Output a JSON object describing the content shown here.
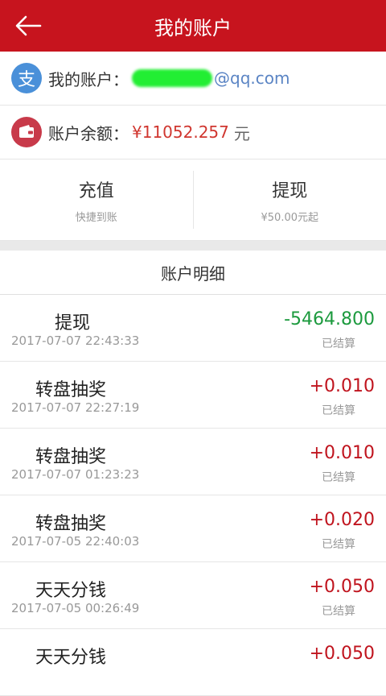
{
  "header": {
    "title": "我的账户"
  },
  "account": {
    "label": "我的账户：",
    "icon_char": "支",
    "email_suffix": "@qq.com"
  },
  "balance": {
    "label": "账户余额：",
    "value": "¥11052.257",
    "unit": "元"
  },
  "actions": [
    {
      "label": "充值",
      "sub": "快捷到账"
    },
    {
      "label": "提现",
      "sub": "¥50.00元起"
    }
  ],
  "detail_title": "账户明细",
  "transactions": [
    {
      "name": "提现",
      "time": "2017-07-07 22:43:33",
      "amount": "-5464.800",
      "status": "已结算"
    },
    {
      "name": "转盘抽奖",
      "time": "2017-07-07 22:27:19",
      "amount": "+0.010",
      "status": "已结算"
    },
    {
      "name": "转盘抽奖",
      "time": "2017-07-07 01:23:23",
      "amount": "+0.010",
      "status": "已结算"
    },
    {
      "name": "转盘抽奖",
      "time": "2017-07-05 22:40:03",
      "amount": "+0.020",
      "status": "已结算"
    },
    {
      "name": "天天分钱",
      "time": "2017-07-05 00:26:49",
      "amount": "+0.050",
      "status": "已结算"
    },
    {
      "name": "天天分钱",
      "time": "",
      "amount": "+0.050",
      "status": ""
    }
  ],
  "colors": {
    "brand": "#c7141e",
    "positive": "#c0141e",
    "negative": "#1c9a3e",
    "link": "#5a84c4"
  }
}
